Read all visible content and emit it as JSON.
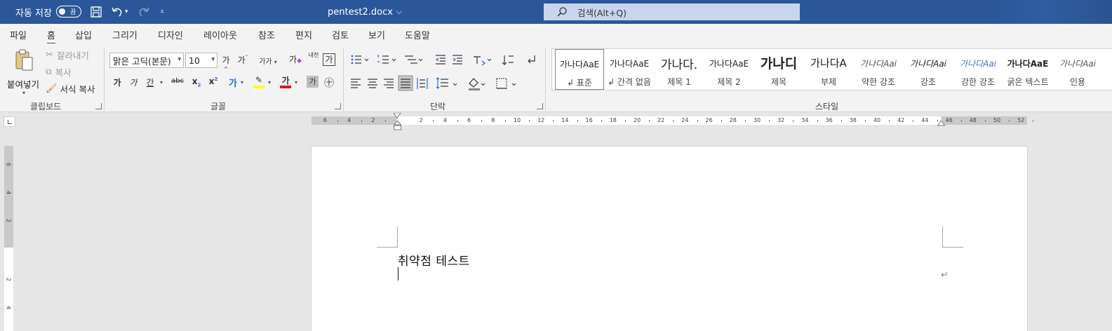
{
  "titlebar": {
    "autosave_label": "자동 저장",
    "autosave_state": "끔",
    "doc_title": "pentest2.docx",
    "search_placeholder": "검색(Alt+Q)"
  },
  "tabs": [
    "파일",
    "홈",
    "삽입",
    "그리기",
    "디자인",
    "레이아웃",
    "참조",
    "편지",
    "검토",
    "보기",
    "도움말"
  ],
  "active_tab": "홈",
  "clipboard": {
    "paste": "붙여넣기",
    "cut": "잘라내기",
    "copy": "복사",
    "format_painter": "서식 복사",
    "group": "클립보드"
  },
  "font": {
    "name": "맑은 고딕(본문)",
    "size": "10",
    "grow": "가",
    "shrink": "가",
    "case": "가가",
    "clear": "가",
    "phonetic": "내천",
    "border": "가",
    "bold": "가",
    "italic": "가",
    "underline": "간",
    "strike": "abc",
    "sub": "x",
    "sup": "x",
    "effects": "가",
    "color": "가",
    "shade": "가",
    "enclose": "㊉",
    "group": "글꼴"
  },
  "paragraph": {
    "group": "단락"
  },
  "styles": {
    "group": "스타일",
    "items": [
      {
        "preview": "가나다AaE",
        "name": "↲ 표준"
      },
      {
        "preview": "가나다AaE",
        "name": "↲ 간격 없음"
      },
      {
        "preview": "가나다.",
        "name": "제목 1"
      },
      {
        "preview": "가나다AaE",
        "name": "제목 2"
      },
      {
        "preview": "가나디",
        "name": "제목"
      },
      {
        "preview": "가나다A",
        "name": "부제"
      },
      {
        "preview": "가나다Aai",
        "name": "약한 강조"
      },
      {
        "preview": "가나다Aai",
        "name": "강조"
      },
      {
        "preview": "가나다Aai",
        "name": "강한 강조"
      },
      {
        "preview": "가나다AaE",
        "name": "굵은 텍스트"
      },
      {
        "preview": "가나다Aai",
        "name": "인용"
      }
    ]
  },
  "ruler": {
    "h_numbers": [
      "6",
      "4",
      "2",
      "2",
      "4",
      "6",
      "8",
      "10",
      "12",
      "14",
      "16",
      "18",
      "20",
      "22",
      "24",
      "26",
      "28",
      "30",
      "32",
      "34",
      "36",
      "38",
      "40",
      "42",
      "44",
      "46",
      "48",
      "50",
      "52"
    ],
    "v_numbers": [
      "6",
      "4",
      "2",
      "2",
      "4"
    ]
  },
  "document": {
    "text": "취약점 테스트",
    "para_mark": "↵"
  },
  "colors": {
    "title_bar": "#2b579a",
    "ribbon": "#f3f3f3",
    "canvas": "#e6e6e6",
    "font_color_bar": "#e81123",
    "highlight_bar": "#ffff00"
  }
}
